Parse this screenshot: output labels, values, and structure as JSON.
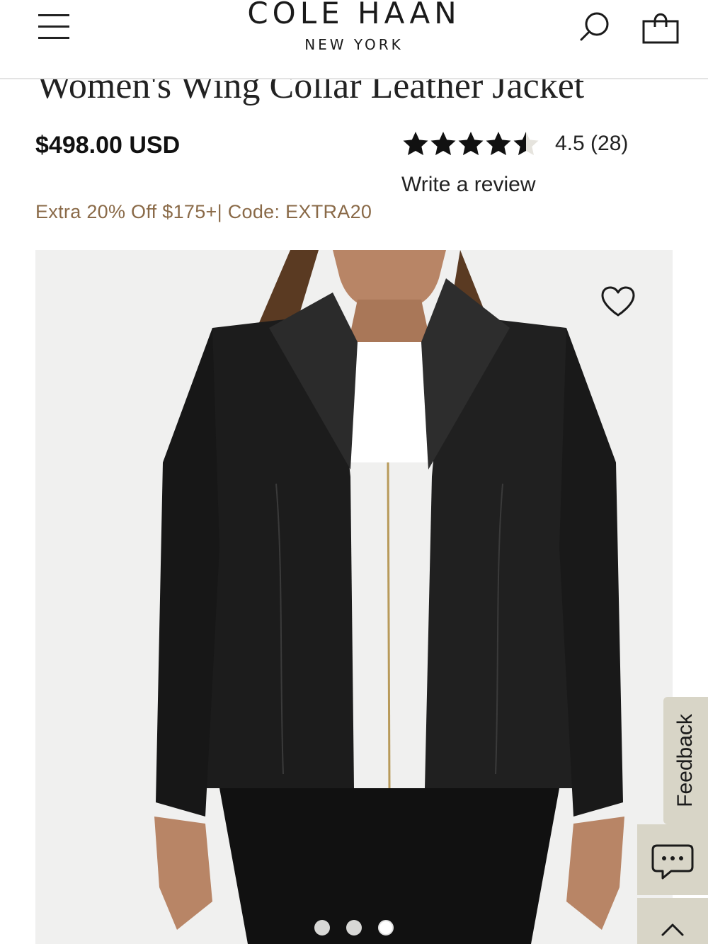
{
  "header": {
    "brand_name": "COLE HAAN",
    "brand_sub": "NEW YORK",
    "icons": [
      "menu-icon",
      "search-icon",
      "shopping-bag-icon"
    ]
  },
  "product": {
    "title": "Women's Wing Collar Leather Jacket",
    "price": "$498.00 USD",
    "rating_value": 4.5,
    "rating_text": "4.5 (28)",
    "write_review_label": "Write a review",
    "promo_text": "Extra 20% Off $175+| Code: EXTRA20",
    "image_count": 3,
    "active_image": 3,
    "wishlist_icon": "heart-icon"
  },
  "feedback": {
    "label": "Feedback",
    "chat_icon": "chat-icon",
    "scroll_icon": "chevron-up-icon"
  },
  "colors": {
    "promo": "#8a6a48",
    "feedback_bg": "#d8d5c7",
    "image_bg": "#f0f0ef",
    "star": "#111111"
  }
}
